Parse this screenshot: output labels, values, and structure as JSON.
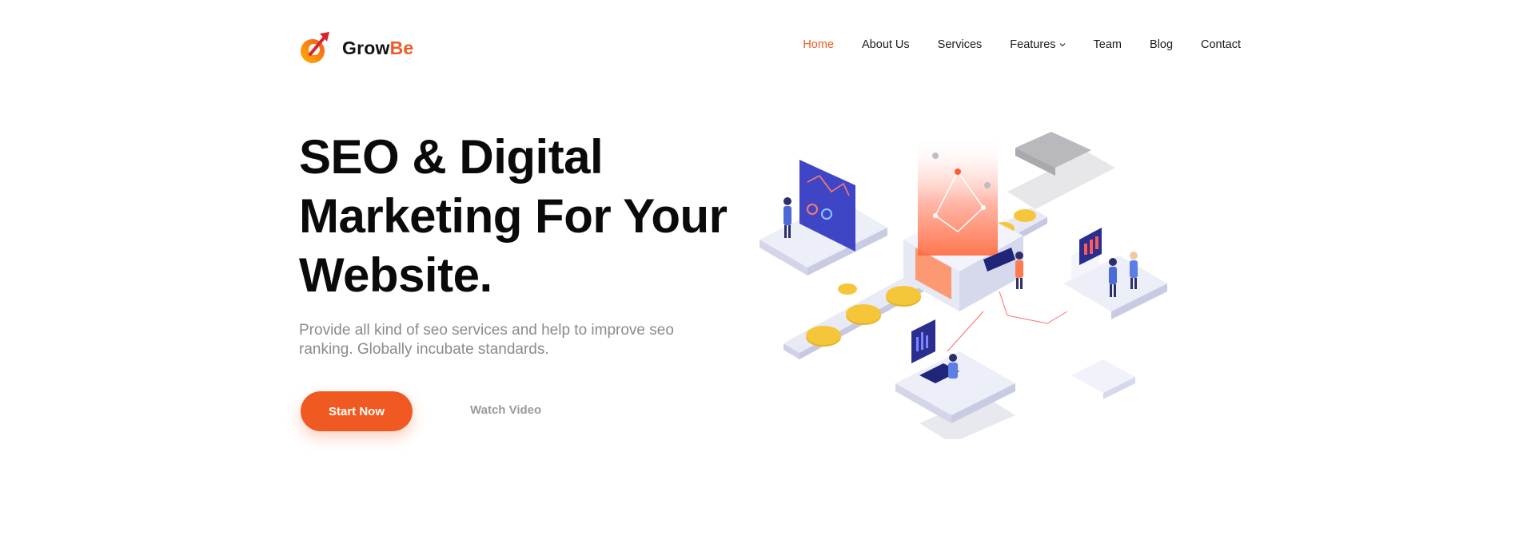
{
  "brand": {
    "name_part1": "Grow",
    "name_part2": "Be",
    "accent_color": "#f05a22"
  },
  "nav": {
    "items": [
      {
        "label": "Home",
        "active": true
      },
      {
        "label": "About Us",
        "active": false
      },
      {
        "label": "Services",
        "active": false
      },
      {
        "label": "Features",
        "active": false,
        "dropdown": true
      },
      {
        "label": "Team",
        "active": false
      },
      {
        "label": "Blog",
        "active": false
      },
      {
        "label": "Contact",
        "active": false
      }
    ]
  },
  "hero": {
    "title": "SEO & Digital Marketing For Your Website.",
    "subtitle": "Provide all kind of seo services and help to improve seo ranking. Globally incubate standards.",
    "primary_button": "Start Now",
    "secondary_button": "Watch Video"
  },
  "illustration": {
    "icon": "isometric-seo-illustration"
  }
}
